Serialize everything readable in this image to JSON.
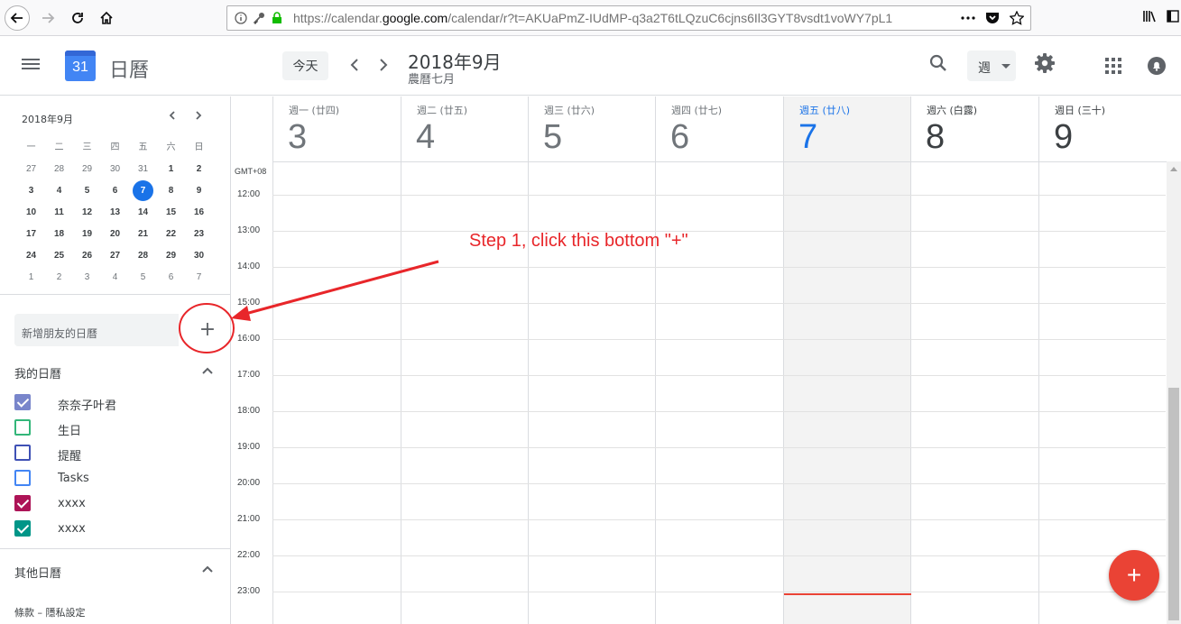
{
  "browser": {
    "url_prefix": "https://calendar.",
    "url_domain": "google.com",
    "url_rest": "/calendar/r?t=AKUaPmZ-IUdMP-q3a2T6tLQzuC6cjns6Il3GYT8vsdt1voWY7pL1",
    "more_icon": "ellipsis-icon",
    "pocket_icon": "pocket-icon",
    "star_icon": "star-icon"
  },
  "header": {
    "logo_day": "31",
    "app_title": "日曆",
    "today_label": "今天",
    "month_title": "2018年9月",
    "lunar_title": "農曆七月",
    "view_label": "週"
  },
  "mini_calendar": {
    "title": "2018年9月",
    "weekdays": [
      "一",
      "二",
      "三",
      "四",
      "五",
      "六",
      "日"
    ],
    "weeks": [
      [
        "27",
        "28",
        "29",
        "30",
        "31",
        "1",
        "2"
      ],
      [
        "3",
        "4",
        "5",
        "6",
        "7",
        "8",
        "9"
      ],
      [
        "10",
        "11",
        "12",
        "13",
        "14",
        "15",
        "16"
      ],
      [
        "17",
        "18",
        "19",
        "20",
        "21",
        "22",
        "23"
      ],
      [
        "24",
        "25",
        "26",
        "27",
        "28",
        "29",
        "30"
      ],
      [
        "1",
        "2",
        "3",
        "4",
        "5",
        "6",
        "7"
      ]
    ],
    "today": "7"
  },
  "sidebar": {
    "add_friend_label": "新增朋友的日曆",
    "add_plus": "+",
    "my_calendars_title": "我的日曆",
    "my_calendars": [
      {
        "label": "奈奈子叶君",
        "color": "#7986cb",
        "checked": true
      },
      {
        "label": "生日",
        "color": "#33b679",
        "checked": false
      },
      {
        "label": "提醒",
        "color": "#3f51b5",
        "checked": false
      },
      {
        "label": "Tasks",
        "color": "#4285f4",
        "checked": false
      },
      {
        "label": "xxxx",
        "color": "#ad1457",
        "checked": true
      },
      {
        "label": "xxxx",
        "color": "#009688",
        "checked": true
      }
    ],
    "other_calendars_title": "其他日曆",
    "footer": "條款 – 隱私設定"
  },
  "week": {
    "timezone": "GMT+08",
    "days": [
      {
        "name": "週一 (廿四)",
        "num": "3",
        "state": "past"
      },
      {
        "name": "週二 (廿五)",
        "num": "4",
        "state": "past"
      },
      {
        "name": "週三 (廿六)",
        "num": "5",
        "state": "past"
      },
      {
        "name": "週四 (廿七)",
        "num": "6",
        "state": "past"
      },
      {
        "name": "週五 (廿八)",
        "num": "7",
        "state": "today"
      },
      {
        "name": "週六 (白露)",
        "num": "8",
        "state": "future"
      },
      {
        "name": "週日 (三十)",
        "num": "9",
        "state": "future"
      }
    ],
    "hours": [
      "12:00",
      "13:00",
      "14:00",
      "15:00",
      "16:00",
      "17:00",
      "18:00",
      "19:00",
      "20:00",
      "21:00",
      "22:00",
      "23:00"
    ]
  },
  "fab_label": "+",
  "annotation": {
    "text": "Step 1, click this bottom \"+\"",
    "color": "#e8262a"
  }
}
